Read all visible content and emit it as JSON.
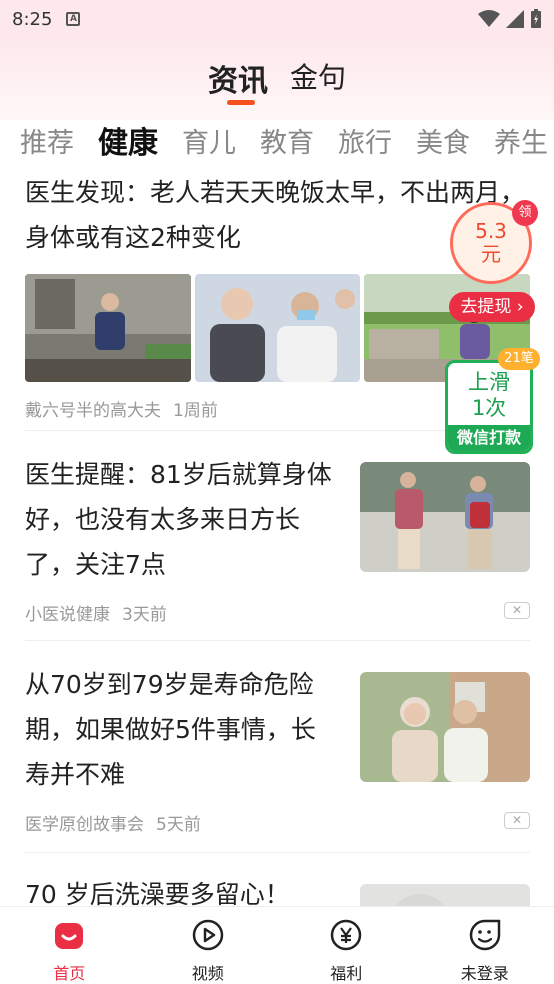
{
  "status": {
    "time": "8:25"
  },
  "main_tabs": [
    "资讯",
    "金句"
  ],
  "categories": [
    "推荐",
    "健康",
    "育儿",
    "教育",
    "旅行",
    "美食",
    "养生"
  ],
  "articles": [
    {
      "title": "医生发现：老人若天天晚饭太早，不出两月，身体或有这2种变化",
      "source": "戴六号半的高大夫",
      "time": "1周前"
    },
    {
      "title": "医生提醒：81岁后就算身体好，也没有太多来日方长了，关注7点",
      "source": "小医说健康",
      "time": "3天前"
    },
    {
      "title": "从70岁到79岁是寿命危险期，如果做好5件事情，长寿并不难",
      "source": "医学原创故事会",
      "time": "5天前"
    },
    {
      "title": "70 岁后洗澡要多留心！"
    }
  ],
  "reward": {
    "amount": "5.3",
    "unit": "元",
    "badge": "领",
    "withdraw": "去提现"
  },
  "slide_card": {
    "line1": "上滑",
    "line2": "1次",
    "footer": "微信打款",
    "count": "21笔"
  },
  "bottom_nav": [
    {
      "label": "首页",
      "icon": "home-icon"
    },
    {
      "label": "视频",
      "icon": "video-play-icon"
    },
    {
      "label": "福利",
      "icon": "yuan-coin-icon"
    },
    {
      "label": "未登录",
      "icon": "smiley-user-icon"
    }
  ],
  "colors": {
    "accent": "#ea2f45",
    "underline": "#f4511e",
    "green": "#1eaa55",
    "header_bg": "#fde8ec"
  }
}
